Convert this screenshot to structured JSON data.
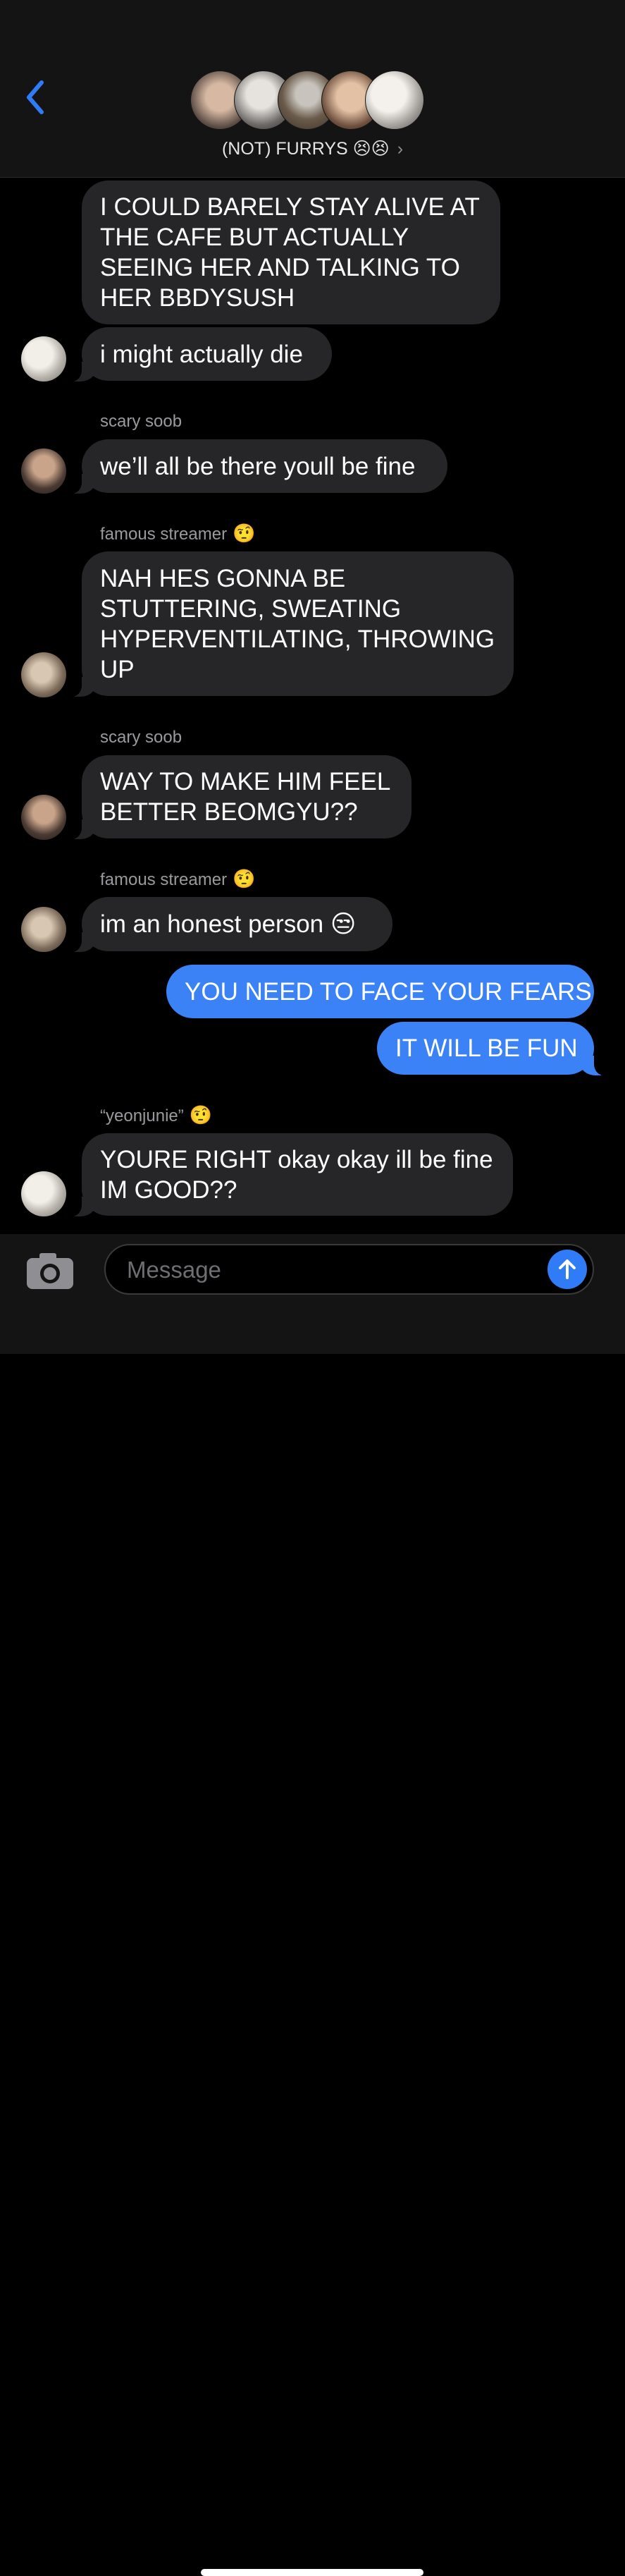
{
  "header": {
    "group_name": "(NOT) FURRYS",
    "group_emoji": "😣😣",
    "chevron": "›",
    "back_icon": "chevron-left-icon"
  },
  "messages": [
    {
      "direction": "in",
      "lines": [
        "I COULD BARELY STAY ALIVE AT",
        "THE CAFE BUT ACTUALLY",
        "SEEING HER AND TALKING TO",
        "HER BBDYSUSH"
      ]
    },
    {
      "direction": "in",
      "lines": [
        "i might actually die"
      ]
    },
    {
      "direction": "in",
      "sender": "scary soob",
      "lines": [
        "we’ll all be there youll be fine"
      ]
    },
    {
      "direction": "in",
      "sender": "famous streamer",
      "sender_emoji": "🤨",
      "lines": [
        "NAH HES GONNA BE",
        "STUTTERING, SWEATING",
        "HYPERVENTILATING, THROWING",
        "UP"
      ]
    },
    {
      "direction": "in",
      "sender": "scary soob",
      "lines": [
        "WAY TO MAKE HIM FEEL",
        "BETTER BEOMGYU??"
      ]
    },
    {
      "direction": "in",
      "sender": "famous streamer",
      "sender_emoji": "🤨",
      "lines": [
        "im an honest person"
      ],
      "emoji": "😒"
    },
    {
      "direction": "out",
      "lines": [
        "YOU NEED TO FACE YOUR FEARS"
      ]
    },
    {
      "direction": "out",
      "lines": [
        "IT WILL BE FUN"
      ]
    },
    {
      "direction": "in",
      "sender": "“yeonjunie”",
      "sender_emoji": "🤨",
      "lines": [
        "YOURE RIGHT okay okay ill be fine",
        "IM GOOD??"
      ]
    }
  ],
  "composer": {
    "placeholder": "Message",
    "camera_icon": "camera-icon",
    "send_icon": "arrow-up-icon"
  },
  "colors": {
    "incoming_bubble": "#262628",
    "outgoing_bubble": "#3b82f6",
    "accent": "#2f7cf6"
  }
}
